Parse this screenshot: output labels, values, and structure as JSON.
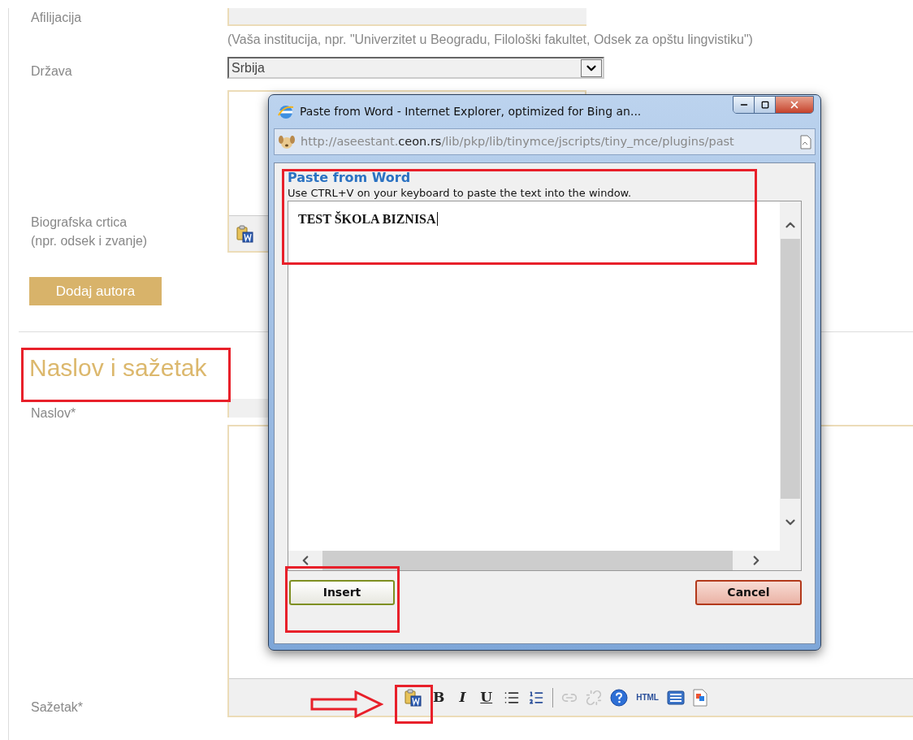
{
  "form": {
    "affiliation": {
      "label": "Afilijacija",
      "hint": "(Vaša institucija, npr. \"Univerzitet u Beogradu, Filološki fakultet, Odsek za opštu lingvistiku\")"
    },
    "country": {
      "label": "Država",
      "value": "Srbija"
    },
    "bio": {
      "label": "Biografska crtica",
      "sublabel": "(npr. odsek i zvanje)",
      "toolbar": [
        {
          "kind": "paste_word",
          "disabled": false
        }
      ]
    },
    "add_author_button": "Dodaj autora",
    "section_heading": "Naslov i sažetak",
    "title_field": {
      "label": "Naslov*"
    },
    "abstract": {
      "label": "Sažetak*",
      "toolbar": [
        {
          "kind": "paste_word",
          "disabled": false
        },
        {
          "kind": "bold",
          "label": "B",
          "disabled": false
        },
        {
          "kind": "italic",
          "label": "I",
          "disabled": false
        },
        {
          "kind": "underline",
          "label": "U",
          "disabled": false
        },
        {
          "kind": "bullets",
          "disabled": false
        },
        {
          "kind": "numbered",
          "disabled": false
        },
        {
          "kind": "separator"
        },
        {
          "kind": "link",
          "disabled": true
        },
        {
          "kind": "unlink",
          "disabled": true
        },
        {
          "kind": "help",
          "disabled": false
        },
        {
          "kind": "html",
          "label": "HTML",
          "disabled": false
        },
        {
          "kind": "panel",
          "disabled": false
        },
        {
          "kind": "image",
          "disabled": false
        }
      ]
    }
  },
  "popup": {
    "title": "Paste from Word - Internet Explorer, optimized for Bing an...",
    "url": {
      "before": "http://aseestant.",
      "domain": "ceon.rs",
      "after": "/lib/pkp/lib/tinymce/jscripts/tiny_mce/plugins/past"
    },
    "heading": "Paste from Word",
    "instructions": "Use CTRL+V on your keyboard to paste the text into the window.",
    "content": "TEST ŠKOLA BIZNISA",
    "buttons": [
      {
        "label": "Insert",
        "kind": "primary"
      },
      {
        "label": "Cancel",
        "kind": "cancel"
      }
    ]
  }
}
